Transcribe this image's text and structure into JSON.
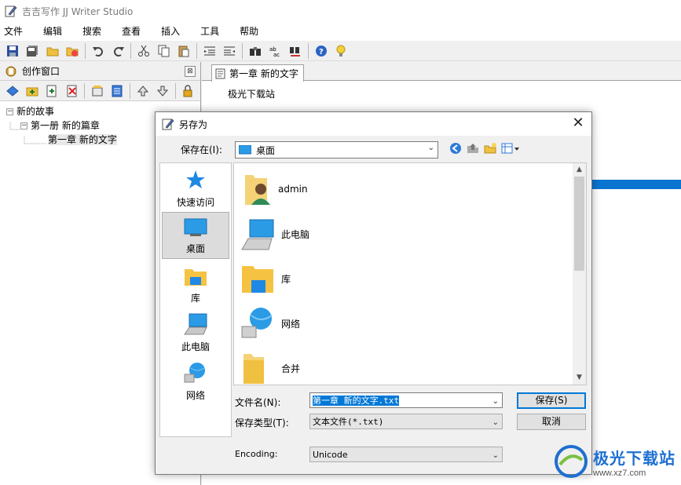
{
  "window": {
    "title": "吉吉写作 JJ Writer Studio"
  },
  "menu": [
    "文件",
    "编辑",
    "搜索",
    "查看",
    "插入",
    "工具",
    "帮助"
  ],
  "colors": {
    "accent": "#0078d7",
    "selection": "#0078d7",
    "window_bg": "#f0f0f0"
  },
  "left_panel": {
    "title": "创作窗口",
    "close_glyph": "⊠",
    "tree": {
      "root": "新的故事",
      "book": "第一册 新的篇章",
      "chapter": "第一章 新的文字"
    }
  },
  "editor": {
    "tab_label": "第一章 新的文字",
    "content": "极光下载站"
  },
  "dialog": {
    "title": "另存为",
    "close_glyph": "✕",
    "save_in_label": "保存在(I):",
    "save_in_value": "桌面",
    "places": [
      "快速访问",
      "桌面",
      "库",
      "此电脑",
      "网络"
    ],
    "active_place": "桌面",
    "files": [
      "admin",
      "此电脑",
      "库",
      "网络",
      "合并"
    ],
    "filename_label": "文件名(N):",
    "filename_value": "第一章 新的文字.txt",
    "filetype_label": "保存类型(T):",
    "filetype_value": "文本文件(*.txt)",
    "encoding_label": "Encoding:",
    "encoding_value": "Unicode",
    "save_button": "保存(S)",
    "cancel_button": "取消"
  },
  "watermark": {
    "text": "极光下载站",
    "url": "www.xz7.com"
  }
}
